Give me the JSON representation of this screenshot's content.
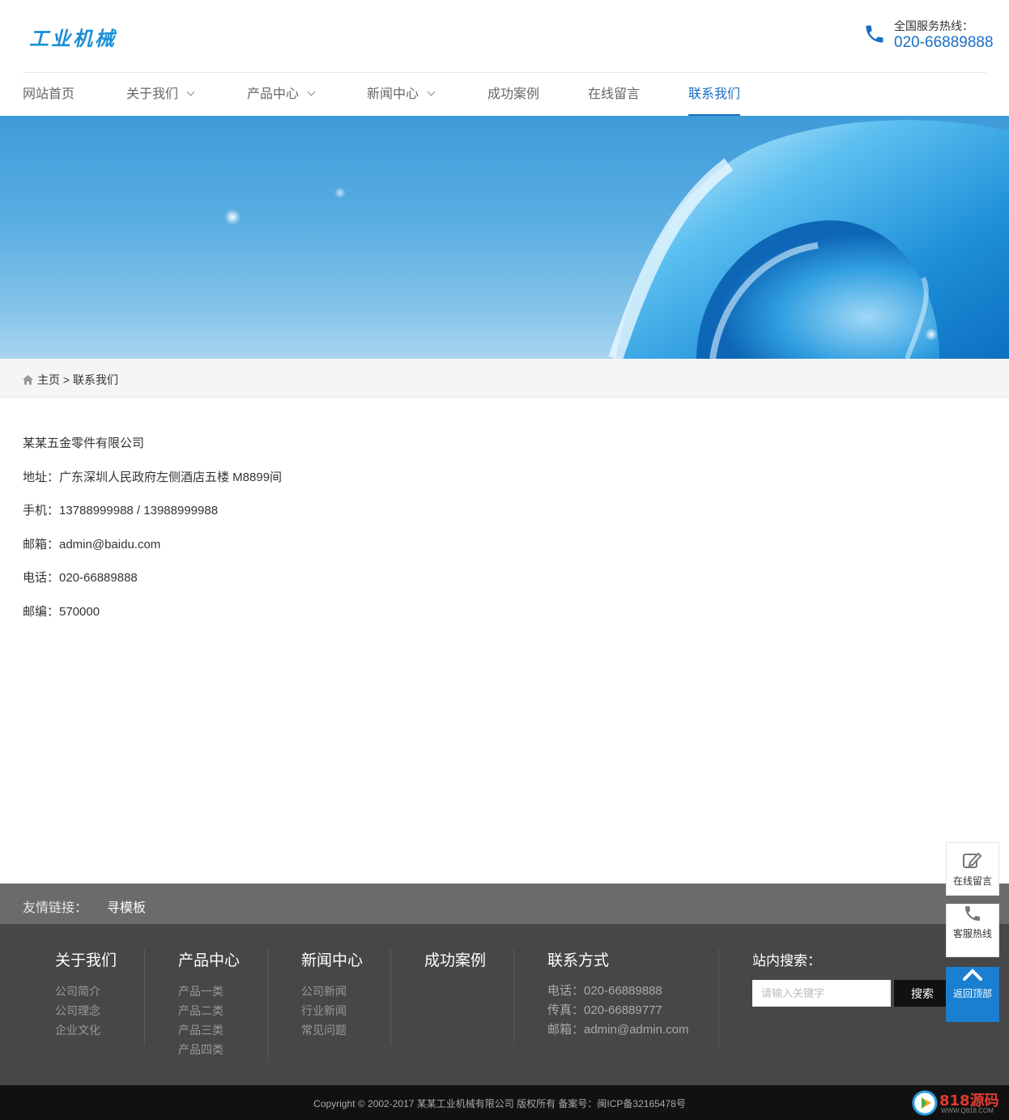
{
  "header": {
    "logo": "工业机械",
    "hotline_label": "全国服务热线：",
    "hotline_number": "020-66889888"
  },
  "nav": [
    {
      "label": "网站首页",
      "has_dropdown": false
    },
    {
      "label": "关于我们",
      "has_dropdown": true
    },
    {
      "label": "产品中心",
      "has_dropdown": true
    },
    {
      "label": "新闻中心",
      "has_dropdown": true
    },
    {
      "label": "成功案例",
      "has_dropdown": false
    },
    {
      "label": "在线留言",
      "has_dropdown": false
    },
    {
      "label": "联系我们",
      "has_dropdown": false,
      "active": true
    }
  ],
  "breadcrumb": {
    "home": "主页",
    "separator": ">",
    "current": "联系我们"
  },
  "contact": {
    "company": "某某五金零件有限公司",
    "address": "地址：广东深圳人民政府左侧酒店五楼 M8899间",
    "mobile": "手机：13788999988 / 13988999988",
    "email": "邮箱：admin@baidu.com",
    "phone": "电话：020-66889888",
    "postcode": "邮编：570000"
  },
  "side_widget": {
    "message": "在线留言",
    "hotline": "客服热线",
    "back_top": "返回顶部"
  },
  "friend_links": {
    "label": "友情链接：",
    "items": [
      "寻模板"
    ]
  },
  "footer": {
    "columns": [
      {
        "title": "关于我们",
        "links": [
          "公司简介",
          "公司理念",
          "企业文化"
        ]
      },
      {
        "title": "产品中心",
        "links": [
          "产品一类",
          "产品二类",
          "产品三类",
          "产品四类"
        ]
      },
      {
        "title": "新闻中心",
        "links": [
          "公司新闻",
          "行业新闻",
          "常见问题"
        ]
      },
      {
        "title": "成功案例",
        "links": []
      }
    ],
    "contact_title": "联系方式",
    "contact_lines": [
      "电话：020-66889888",
      "传真：020-66889777",
      "邮箱：admin@admin.com"
    ],
    "search_label": "站内搜索：",
    "search_placeholder": "请输入关键字",
    "search_button": "搜索",
    "copyright": "Copyright © 2002-2017 某某工业机械有限公司 版权所有    备案号：闽ICP备32165478号"
  },
  "watermark": {
    "text": "818源码",
    "sub": "WWW.Q818.COM"
  },
  "colors": {
    "accent": "#1a6fc4",
    "footer_bg": "#474747",
    "links_bg": "#6b6b6b",
    "copyright_bg": "#111111"
  }
}
